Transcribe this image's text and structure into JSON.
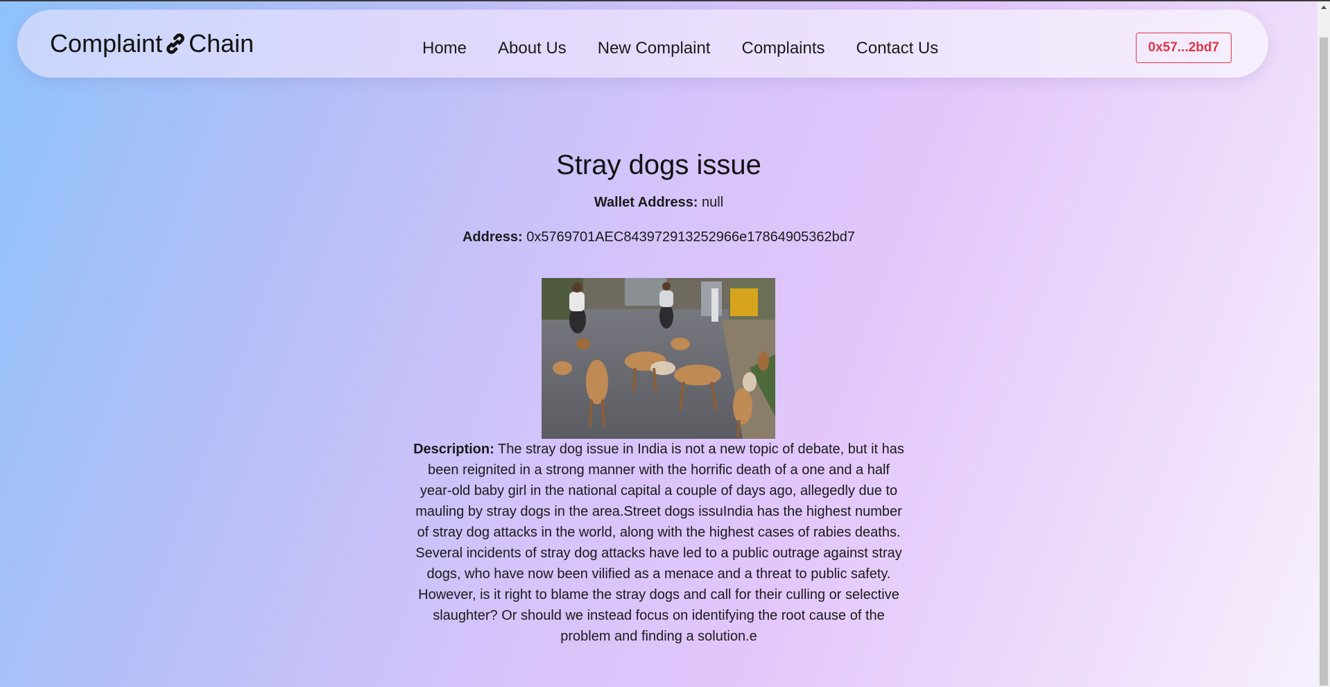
{
  "brand": {
    "name_left": "Complaint",
    "name_right": "Chain",
    "icon": "link-icon"
  },
  "nav": {
    "items": [
      "Home",
      "About Us",
      "New Complaint",
      "Complaints",
      "Contact Us"
    ]
  },
  "wallet_button": {
    "label": "0x57...2bd7",
    "color": "#dc3545"
  },
  "complaint": {
    "title": "Stray dogs issue",
    "wallet_label": "Wallet Address:",
    "wallet_value": "null",
    "address_label": "Address:",
    "address_value": "0x5769701AEC843972913252966e17864905362bd7",
    "image": "stray-dogs-street-photo",
    "description_label": "Description:",
    "description_text": "The stray dog issue in India is not a new topic of debate, but it has been reignited in a strong manner with the horrific death of a one and a half year-old baby girl in the national capital a couple of days ago, allegedly due to mauling by stray dogs in the area.Street dogs issuIndia has the highest number of stray dog attacks in the world, along with the highest cases of rabies deaths. Several incidents of stray dog attacks have led to a public outrage against stray dogs, who have now been vilified as a menace and a threat to public safety. However, is it right to blame the stray dogs and call for their culling or selective slaughter? Or should we instead focus on identifying the root cause of the problem and finding a solution.e"
  }
}
